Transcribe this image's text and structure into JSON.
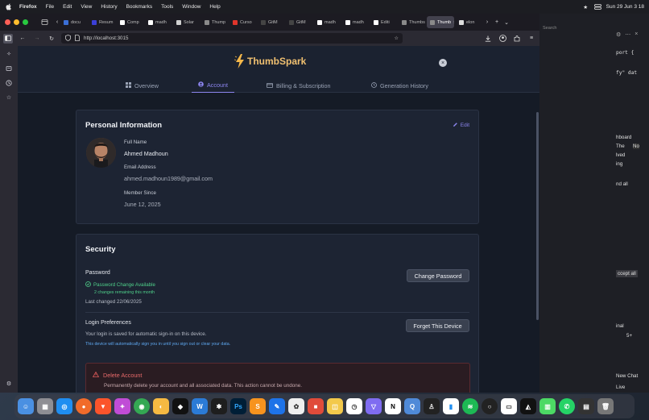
{
  "menubar": {
    "app": "Firefox",
    "items": [
      "File",
      "Edit",
      "View",
      "History",
      "Bookmarks",
      "Tools",
      "Window",
      "Help"
    ],
    "clock": "Sun 29 Jun 3 18"
  },
  "browser": {
    "tabs": [
      {
        "label": "docu",
        "color": "#3b6fd6"
      },
      {
        "label": "Resum",
        "color": "#3b3fd6"
      },
      {
        "label": "Comp",
        "color": "#ffffff"
      },
      {
        "label": "madh",
        "color": "#ffffff"
      },
      {
        "label": "Solar",
        "color": "#d0d0d0"
      },
      {
        "label": "Thump",
        "color": "#8a8a8a"
      },
      {
        "label": "Curso",
        "color": "#e0352b"
      },
      {
        "label": "GitM",
        "color": "#444444"
      },
      {
        "label": "GitM",
        "color": "#444444"
      },
      {
        "label": "madh",
        "color": "#ffffff"
      },
      {
        "label": "madh",
        "color": "#ffffff"
      },
      {
        "label": "Editi",
        "color": "#ffffff"
      },
      {
        "label": "Thumbs",
        "color": "#8a8a8a"
      },
      {
        "label": "Thumb",
        "color": "#8a8a8a",
        "active": true
      },
      {
        "label": "elon",
        "color": "#dddddd"
      }
    ],
    "url": "http://localhost:3015"
  },
  "app": {
    "logo_text": "ThumbSpark",
    "nav": {
      "overview": "Overview",
      "account": "Account",
      "billing": "Billing & Subscription",
      "history": "Generation History"
    },
    "personal": {
      "title": "Personal Information",
      "edit": "Edit",
      "full_name_label": "Full Name",
      "full_name": "Ahmed Madhoun",
      "email_label": "Email Address",
      "email": "ahmed.madhoun1989@gmail.com",
      "member_since_label": "Member Since",
      "member_since": "June 12, 2025"
    },
    "security": {
      "title": "Security",
      "password_label": "Password",
      "password_status": "Password Change Available",
      "changes_remaining": "2 changes remaining this month",
      "last_changed": "Last changed 22/06/2025",
      "change_password_button": "Change Password",
      "login_prefs_label": "Login Preferences",
      "login_prefs_desc": "Your login is saved for automatic sign-in on this device.",
      "login_prefs_note": "This device will automatically sign you in until you sign out or clear your data.",
      "forget_device_button": "Forget This Device",
      "delete_title": "Delete Account",
      "delete_desc": "Permanently delete your account and all associated data. This action cannot be undone."
    }
  },
  "editor": {
    "search_placeholder": "Search",
    "lines": [
      "port {",
      "fy\" dat",
      "hboard",
      "The",
      "No",
      "lved",
      "ing",
      "nd all",
      "ccept all",
      "inal",
      "5+",
      "New Chat",
      "Live"
    ]
  },
  "colors": {
    "accent": "#8d86f0",
    "success": "#4fd08a",
    "danger": "#e05a5a",
    "note": "#5fa8f0"
  }
}
